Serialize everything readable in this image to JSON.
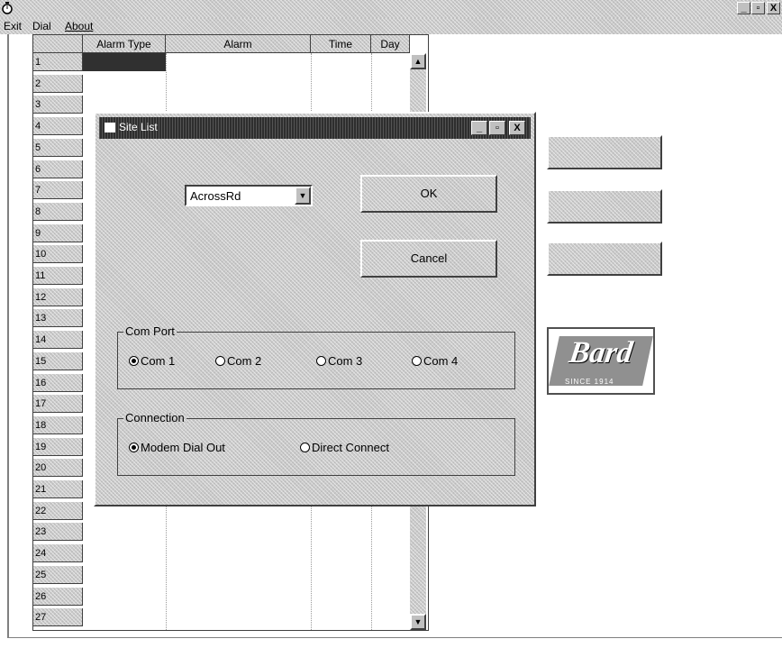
{
  "window": {
    "controls": {
      "minimize": "_",
      "maximize": "▫",
      "close": "X"
    }
  },
  "menu": {
    "items": [
      "Exit",
      "Dial",
      "About"
    ]
  },
  "grid": {
    "columns": [
      "Alarm Type",
      "Alarm",
      "Time",
      "Day"
    ],
    "rows": [
      "1",
      "2",
      "3",
      "4",
      "5",
      "6",
      "7",
      "8",
      "9",
      "10",
      "11",
      "12",
      "13",
      "14",
      "15",
      "16",
      "17",
      "18",
      "19",
      "20",
      "21",
      "22",
      "23",
      "24",
      "25",
      "26",
      "27"
    ],
    "scroll_up": "▲",
    "scroll_down": "▼"
  },
  "right_buttons": [
    "",
    "",
    ""
  ],
  "logo": {
    "text": "Bard",
    "tagline": "SINCE 1914"
  },
  "dialog": {
    "title": "Site List",
    "controls": {
      "minimize": "_",
      "maximize": "▫",
      "close": "X"
    },
    "site_select": {
      "value": "AcrossRd",
      "arrow": "▼"
    },
    "ok_label": "OK",
    "cancel_label": "Cancel",
    "com_port": {
      "label": "Com Port",
      "options": [
        "Com 1",
        "Com 2",
        "Com 3",
        "Com 4"
      ],
      "selected": "Com 1"
    },
    "connection": {
      "label": "Connection",
      "options": [
        "Modem Dial Out",
        "Direct Connect"
      ],
      "selected": "Modem Dial Out"
    }
  }
}
